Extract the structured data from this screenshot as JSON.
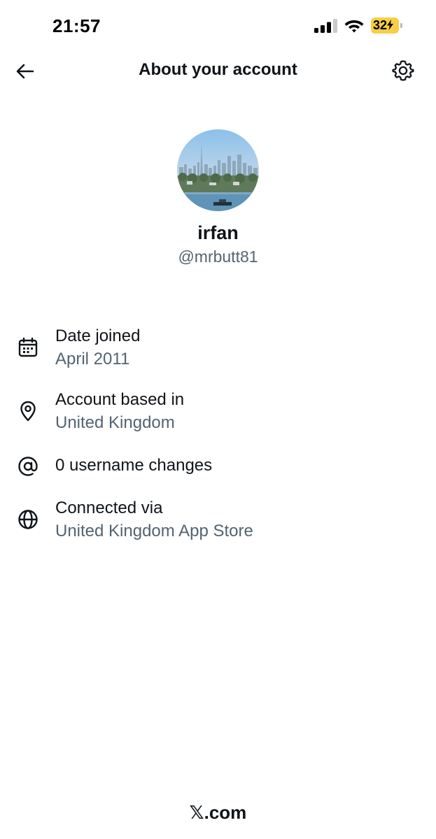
{
  "status_bar": {
    "time": "21:57",
    "battery_level": "32",
    "battery_color": "#f7cf46",
    "signal_bars_active": 3,
    "signal_bars_total": 4
  },
  "header": {
    "title": "About your account",
    "back_icon": "arrow-left-icon",
    "settings_icon": "gear-icon"
  },
  "profile": {
    "name": "irfan",
    "handle": "@mrbutt81",
    "avatar": "city-skyline-avatar"
  },
  "info": [
    {
      "icon": "calendar-icon",
      "label": "Date joined",
      "value": "April 2011"
    },
    {
      "icon": "location-pin-icon",
      "label": "Account based in",
      "value": "United Kingdom"
    },
    {
      "icon": "at-sign-icon",
      "label": "0 username changes",
      "value": ""
    },
    {
      "icon": "globe-icon",
      "label": "Connected via",
      "value": "United Kingdom App Store"
    }
  ],
  "footer": {
    "brand": "𝕏.com"
  },
  "colors": {
    "primary_text": "#0f1419",
    "secondary_text": "#536471",
    "background": "#ffffff"
  }
}
